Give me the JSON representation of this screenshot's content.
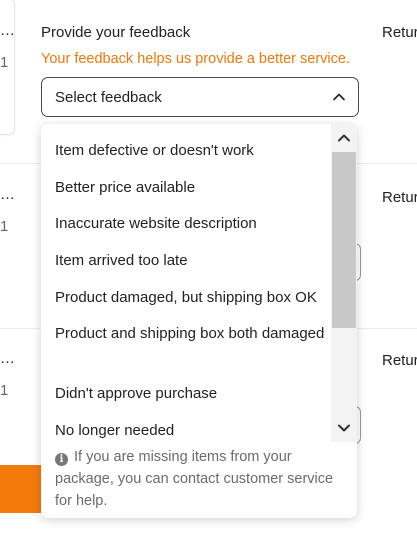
{
  "left": {
    "card1": {
      "dots": "…",
      "num": "1"
    },
    "card2": {
      "dots": "…",
      "num": "1"
    },
    "card3": {
      "dots": "…",
      "num": "1"
    }
  },
  "right": {
    "row1": "Retur",
    "row2": "Retur",
    "row3": "Retur"
  },
  "feedback": {
    "title": "Provide your feedback",
    "subtitle": "Your feedback helps us provide a better service.",
    "select_value": "Select feedback",
    "options": [
      "Item defective or doesn't work",
      "Better price available",
      "Inaccurate website description",
      "Item arrived too late",
      "Product damaged, but shipping box OK",
      "Product and shipping box both damaged",
      "Didn't approve purchase",
      "No longer needed"
    ],
    "info_icon": "info-icon",
    "info_text": "If you are missing items from your package, you can contact customer service for help."
  },
  "colors": {
    "accent": "#f47a0c",
    "subtitle": "#ea7a0b"
  }
}
